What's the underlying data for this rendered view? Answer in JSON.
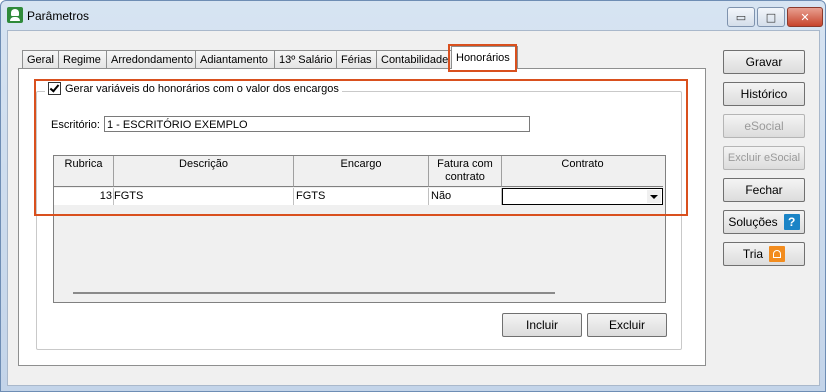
{
  "window": {
    "title": "Parâmetros",
    "controls": {
      "minimize": "▭",
      "maximize": "□",
      "close": "✕"
    }
  },
  "tabs": [
    "Geral",
    "Regime",
    "Arredondamento",
    "Adiantamento",
    "13º Salário",
    "Férias",
    "Contabilidade",
    "Honorários"
  ],
  "active_tab": "Honorários",
  "group": {
    "checkbox_label": "Gerar variáveis do honorários com o valor dos encargos",
    "checked": true
  },
  "escritorio": {
    "label": "Escritório:",
    "value": "1 - ESCRITÓRIO EXEMPLO"
  },
  "grid": {
    "headers": [
      "Rubrica",
      "Descrição",
      "Encargo",
      "Fatura com contrato",
      "Contrato"
    ],
    "rows": [
      {
        "rubrica": "13",
        "descricao": "FGTS",
        "encargo": "FGTS",
        "fatura": "Não",
        "contrato": ""
      }
    ]
  },
  "buttons": {
    "incluir": "Incluir",
    "excluir": "Excluir",
    "gravar": "Gravar",
    "historico": "Histórico",
    "esocial": "eSocial",
    "excluir_esocial": "Excluir eSocial",
    "fechar": "Fechar",
    "solucoes": "Soluções",
    "tria": "Tria",
    "help_glyph": "?"
  },
  "colors": {
    "highlight": "#d9501e",
    "help_icon": "#1a84c6",
    "tria_icon": "#f28c1e"
  }
}
